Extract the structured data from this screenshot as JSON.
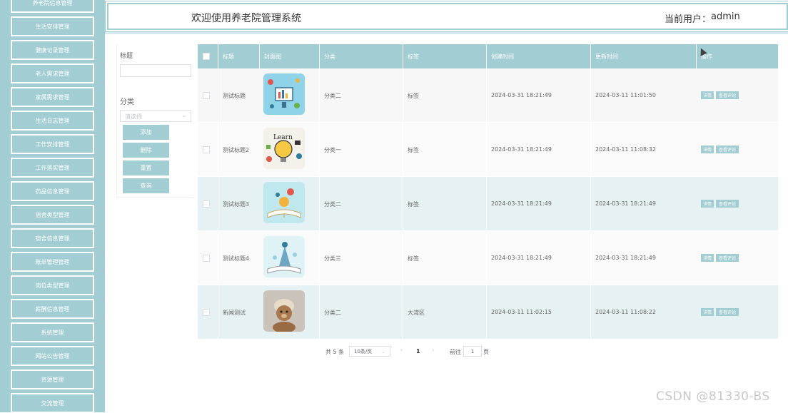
{
  "header": {
    "title": "欢迎使用养老院管理系统",
    "user_label": "当前用户：",
    "user_name": "admin"
  },
  "sidebar": {
    "items": [
      {
        "label": "养老院信息管理"
      },
      {
        "label": "生活安排管理"
      },
      {
        "label": "健康记录管理"
      },
      {
        "label": "老人需求管理"
      },
      {
        "label": "家属需求管理"
      },
      {
        "label": "生活日志管理"
      },
      {
        "label": "工作安排管理"
      },
      {
        "label": "工作落实管理"
      },
      {
        "label": "药品信息管理"
      },
      {
        "label": "宿舍类型管理"
      },
      {
        "label": "宿舍信息管理"
      },
      {
        "label": "账单管理管理"
      },
      {
        "label": "岗位类型管理"
      },
      {
        "label": "薪酬信息管理"
      },
      {
        "label": "系统管理"
      },
      {
        "label": "网站公告管理"
      },
      {
        "label": "资源管理"
      },
      {
        "label": "交流管理"
      }
    ]
  },
  "filter": {
    "title_label": "标题",
    "category_label": "分类",
    "category_placeholder": "请选择",
    "buttons": {
      "add": "添加",
      "delete": "删除",
      "reset": "重置",
      "search": "查询"
    }
  },
  "table": {
    "columns": [
      "标题",
      "封面图",
      "分类",
      "标签",
      "创建时间",
      "更新时间",
      "操作"
    ],
    "rows": [
      {
        "title": "测试标题",
        "category": "分类二",
        "tag": "标签",
        "created": "2024-03-31 18:21:49",
        "updated": "2024-03-11 11:01:50",
        "thumb": "thumb-1"
      },
      {
        "title": "测试标题2",
        "category": "分类一",
        "tag": "标签",
        "created": "2024-03-31 18:21:49",
        "updated": "2024-03-11 11:08:32",
        "thumb": "thumb-2"
      },
      {
        "title": "测试标题3",
        "category": "分类二",
        "tag": "标签",
        "created": "2024-03-31 18:21:49",
        "updated": "2024-03-31 18:21:49",
        "thumb": "thumb-3"
      },
      {
        "title": "测试标题4",
        "category": "分类三",
        "tag": "标签",
        "created": "2024-03-31 18:21:49",
        "updated": "2024-03-31 18:21:49",
        "thumb": "thumb-4"
      },
      {
        "title": "新闻测试",
        "category": "分类二",
        "tag": "大湾区",
        "created": "2024-03-11 11:02:15",
        "updated": "2024-03-11 11:08:22",
        "thumb": "thumb-5"
      }
    ],
    "row_actions": {
      "detail": "详情",
      "comments": "查看评论"
    }
  },
  "pagination": {
    "total": "共 5 条",
    "page_size": "10条/页",
    "prev": "‹",
    "current": "1",
    "next": "›",
    "goto_label": "前往",
    "goto_value": "1",
    "page_suffix": "页"
  },
  "watermark": "CSDN @81330-BS",
  "colors": {
    "accent": "#a2cdd3",
    "row_alt": "#e5f1f2"
  }
}
